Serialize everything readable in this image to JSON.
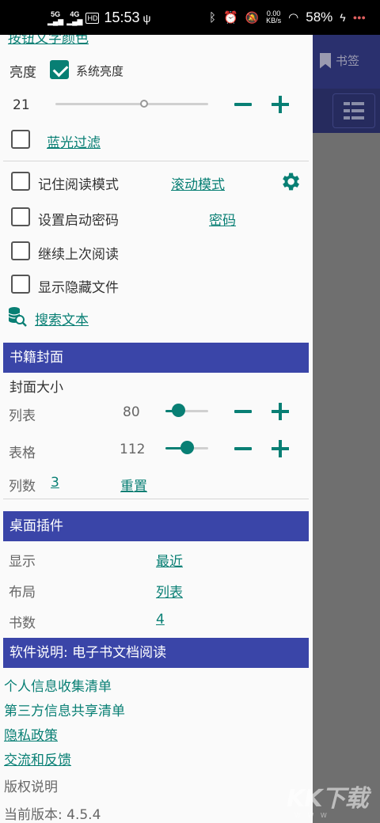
{
  "status_bar": {
    "net1": "5G",
    "net2": "4G",
    "hd": "HD",
    "time": "15:53",
    "speed_value": "0.00",
    "speed_unit": "KB/s",
    "battery": "58%"
  },
  "background": {
    "bookmark_label": "书签",
    "watermark": "KK下载",
    "watermark_sub": "W W W"
  },
  "drawer": {
    "cut_off_top": "按钮文字颜色",
    "brightness": {
      "label": "亮度",
      "system_checkbox_label": "系统亮度",
      "system_checked": true,
      "value": "21",
      "level_fraction": 0.58
    },
    "blue_filter": {
      "label": "蓝光过滤",
      "checked": false
    },
    "remember_mode": {
      "label": "记住阅读模式",
      "checked": false,
      "mode_link": "滚动模式"
    },
    "startup_password": {
      "label": "设置启动密码",
      "checked": false,
      "link": "密码"
    },
    "continue_reading": {
      "label": "继续上次阅读",
      "checked": false
    },
    "show_hidden": {
      "label": "显示隐藏文件",
      "checked": false
    },
    "search_text": "搜索文本",
    "cover_section": {
      "title": "书籍封面",
      "size_label": "封面大小",
      "list_label": "列表",
      "list_value": "80",
      "list_fraction": 0.3,
      "grid_label": "表格",
      "grid_value": "112",
      "grid_fraction": 0.5,
      "columns_label": "列数",
      "columns_value": "3",
      "reset_label": "重置"
    },
    "widget_section": {
      "title": "桌面插件",
      "display_label": "显示",
      "display_value": "最近",
      "layout_label": "布局",
      "layout_value": "列表",
      "count_label": "书数",
      "count_value": "4"
    },
    "about_section": {
      "title": "软件说明: 电子书文档阅读",
      "personal_info": "个人信息收集清单",
      "third_party": "第三方信息共享清单",
      "privacy": "隐私政策",
      "feedback": "交流和反馈",
      "copyright": "版权说明",
      "version": "当前版本: 4.5.4"
    }
  },
  "colors": {
    "accent": "#087f74",
    "section_header": "#3a45a8",
    "app_header": "#2a306e"
  }
}
